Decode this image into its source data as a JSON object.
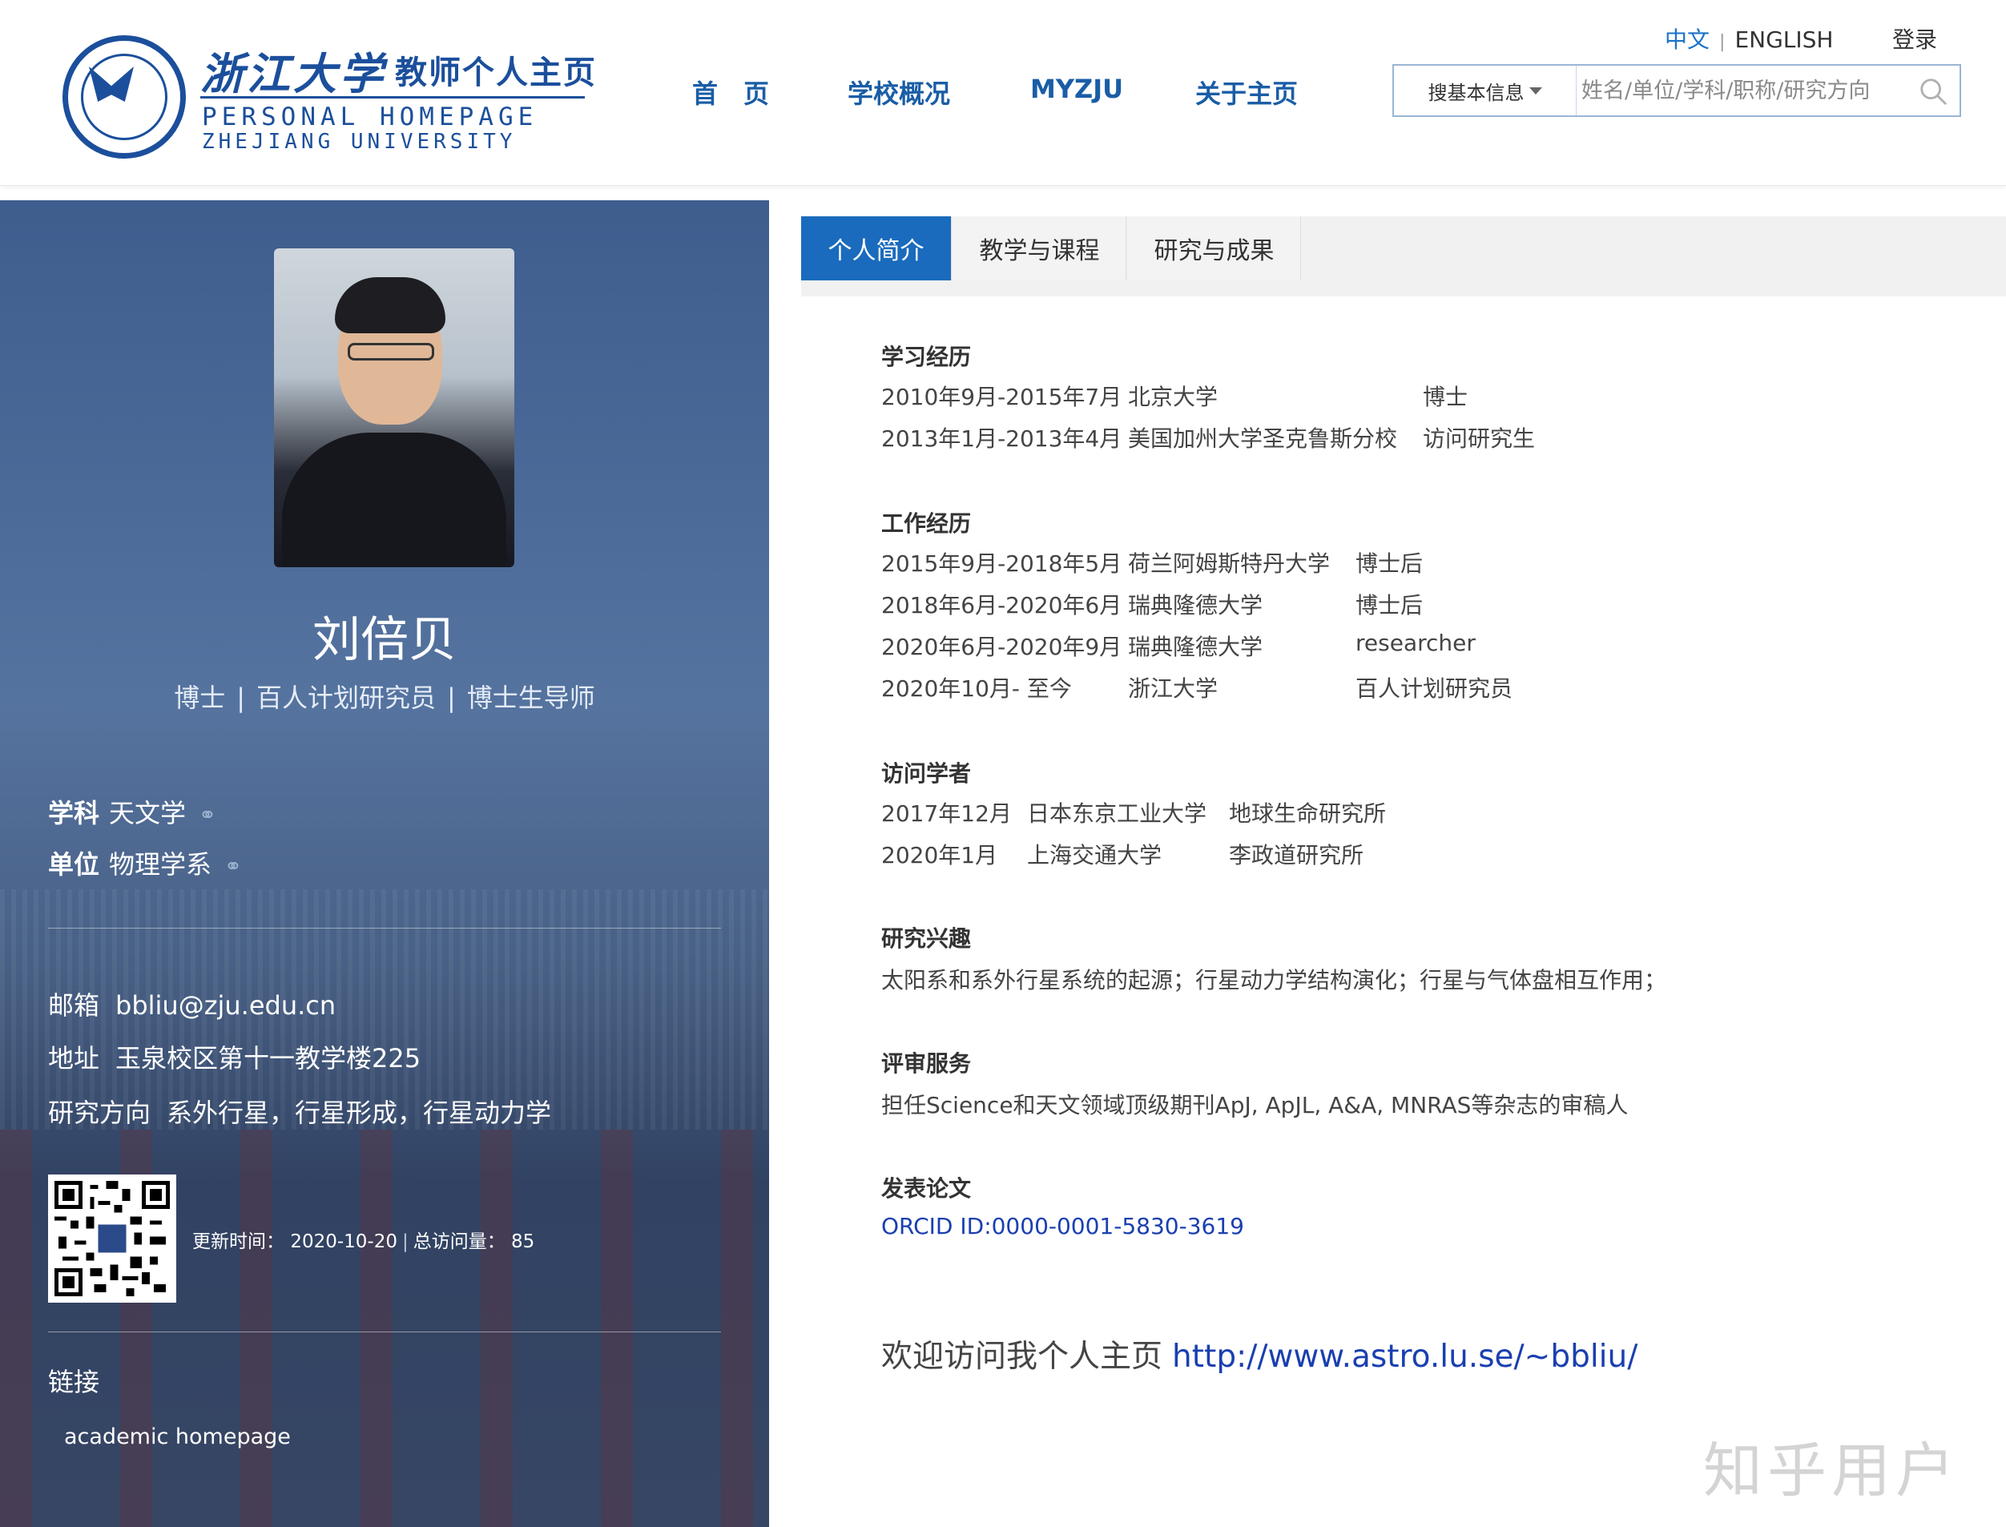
{
  "header": {
    "logo": {
      "cn": "浙江大学",
      "cn_sub": "教师个人主页",
      "en1": "PERSONAL HOMEPAGE",
      "en2": "ZHEJIANG UNIVERSITY"
    },
    "nav": [
      "首　页",
      "学校概况",
      "MYZJU",
      "关于主页"
    ],
    "lang_cn": "中文",
    "lang_en": "ENGLISH",
    "login": "登录",
    "search": {
      "select": "搜基本信息",
      "placeholder": "姓名/单位/学科/职称/研究方向"
    }
  },
  "profile": {
    "name": "刘倍贝",
    "titles": [
      "博士",
      "百人计划研究员",
      "博士生导师"
    ],
    "subject_label": "学科",
    "subject": "天文学",
    "unit_label": "单位",
    "unit": "物理学系",
    "email_label": "邮箱",
    "email": "bbliu@zju.edu.cn",
    "address_label": "地址",
    "address": "玉泉校区第十一教学楼225",
    "research_label": "研究方向",
    "research": "系外行星，行星形成，行星动力学",
    "update_label": "更新时间：",
    "update_date": "2020-10-20",
    "visits_label": "总访问量：",
    "visits": "85",
    "links_title": "链接",
    "links": [
      "academic homepage"
    ]
  },
  "tabs": [
    "个人简介",
    "教学与课程",
    "研究与成果"
  ],
  "content": {
    "education": {
      "title": "学习经历",
      "rows": [
        [
          "2010年9月-2015年7月",
          "北京大学",
          "博士"
        ],
        [
          "2013年1月-2013年4月",
          "美国加州大学圣克鲁斯分校",
          "访问研究生"
        ]
      ]
    },
    "work": {
      "title": "工作经历",
      "rows": [
        [
          "2015年9月-2018年5月",
          "荷兰阿姆斯特丹大学",
          "博士后"
        ],
        [
          "2018年6月-2020年6月",
          "瑞典隆德大学",
          "博士后"
        ],
        [
          "2020年6月-2020年9月",
          "瑞典隆德大学",
          "researcher"
        ],
        [
          "2020年10月- 至今",
          "浙江大学",
          "百人计划研究员"
        ]
      ]
    },
    "visiting": {
      "title": "访问学者",
      "rows": [
        [
          "2017年12月",
          "日本东京工业大学",
          "地球生命研究所"
        ],
        [
          "2020年1月",
          "上海交通大学",
          "李政道研究所"
        ]
      ]
    },
    "interests": {
      "title": "研究兴趣",
      "text": "太阳系和系外行星系统的起源；行星动力学结构演化；行星与气体盘相互作用；"
    },
    "review": {
      "title": "评审服务",
      "text": "担任Science和天文领域顶级期刊ApJ, ApJL, A&A, MNRAS等杂志的审稿人"
    },
    "papers": {
      "title": "发表论文",
      "orcid": "ORCID ID:0000-0001-5830-3619"
    },
    "welcome_text": "欢迎访问我个人主页",
    "welcome_url": "http://www.astro.lu.se/~bbliu/"
  },
  "watermark": "知乎用户"
}
